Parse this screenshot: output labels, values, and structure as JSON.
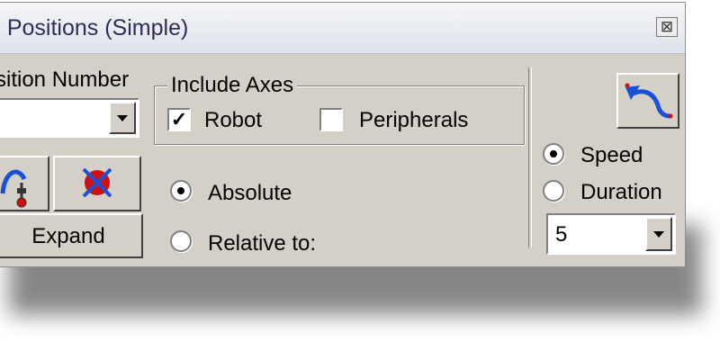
{
  "window": {
    "title": "h Positions (Simple)",
    "close_icon": "close-icon"
  },
  "position": {
    "label": "sition Number",
    "value": ""
  },
  "buttons": {
    "expand_label": "Expand",
    "robot_move_icon": "robot-move-icon",
    "delete_icon": "delete-position-icon",
    "path_icon": "path-move-icon"
  },
  "axes": {
    "group_label": "Include Axes",
    "robot_label": "Robot",
    "robot_checked": true,
    "peripherals_label": "Peripherals",
    "peripherals_checked": false
  },
  "mode": {
    "absolute_label": "Absolute",
    "relative_label": "Relative to:",
    "selected": "absolute"
  },
  "motion": {
    "speed_label": "Speed",
    "duration_label": "Duration",
    "selected": "speed",
    "value": "5"
  },
  "colors": {
    "background": "#d4d0c8",
    "title_text": "#2a2f58",
    "arrow_blue": "#1a4fd8",
    "marker_red": "#d01010"
  }
}
